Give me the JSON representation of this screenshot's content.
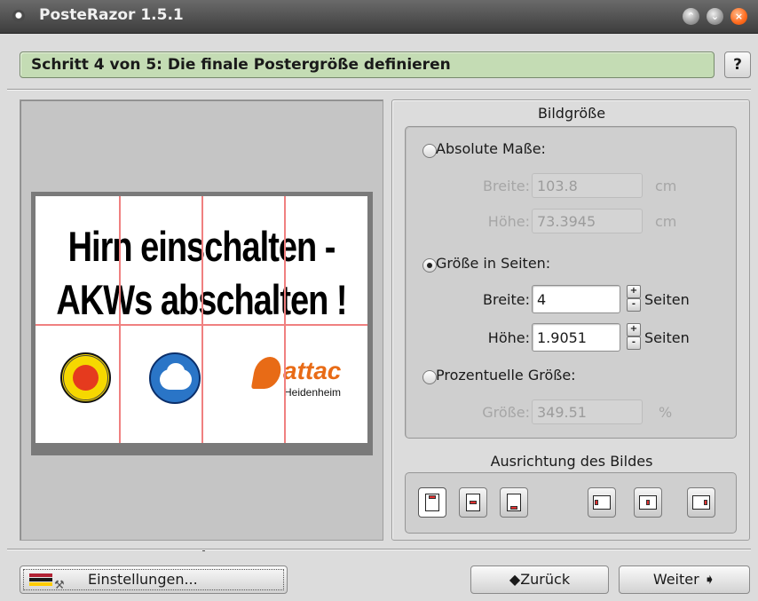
{
  "window": {
    "title": "PosteRazor 1.5.1"
  },
  "step": {
    "text": "Schritt 4 von 5: Die finale Postergröße definieren",
    "help_label": "?"
  },
  "poster": {
    "line1": "Hirn einschalten -",
    "line2": "AKWs abschalten !",
    "logo_attac": "attac",
    "logo_attac_sub": "Heidenheim"
  },
  "image_size": {
    "title": "Bildgröße",
    "absolute": {
      "label": "Absolute Maße:",
      "selected": false,
      "width_label": "Breite:",
      "width_value": "103.8",
      "width_unit": "cm",
      "height_label": "Höhe:",
      "height_value": "73.3945",
      "height_unit": "cm"
    },
    "pages": {
      "label": "Größe in Seiten:",
      "selected": true,
      "width_label": "Breite:",
      "width_value": "4",
      "width_unit": "Seiten",
      "height_label": "Höhe:",
      "height_value": "1.9051",
      "height_unit": "Seiten",
      "spin_up": "+",
      "spin_down": "-"
    },
    "percent": {
      "label": "Prozentuelle Größe:",
      "selected": false,
      "size_label": "Größe:",
      "size_value": "349.51",
      "size_unit": "%"
    }
  },
  "alignment": {
    "title": "Ausrichtung des Bildes",
    "selected_index": 0
  },
  "footer": {
    "settings_label": "Einstellungen...",
    "back_label": "Zurück",
    "next_label": "Weiter",
    "back_icon": "◆",
    "next_icon": "➧"
  },
  "colors": {
    "step_bg": "#c4dcb4",
    "grid_line": "#f08080",
    "close_button": "#ff6a1c"
  }
}
